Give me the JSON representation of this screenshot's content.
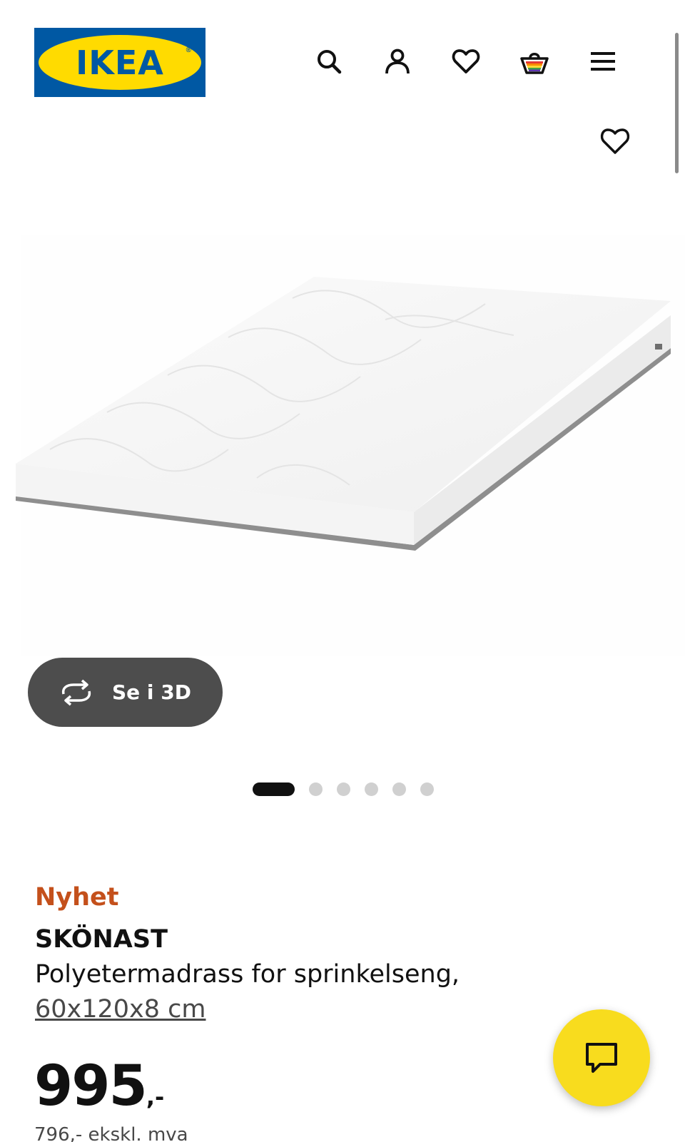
{
  "header": {
    "logo_text": "IKEA",
    "logo_reg_mark": "®",
    "icons": [
      "search-icon",
      "account-icon",
      "favourites-icon",
      "basket-icon",
      "menu-icon"
    ]
  },
  "gallery": {
    "view_3d_label": "Se i 3D",
    "image_count": 6,
    "active_image_index": 0
  },
  "product": {
    "badge": "Nyhet",
    "name": "SKÖNAST",
    "description": "Polyetermadrass for sprinkelseng,",
    "size": "60x120x8 cm",
    "price_integer": "995",
    "price_suffix": ",-",
    "price_ex_vat": "796,- ekskl. mva"
  },
  "colors": {
    "brand_blue": "#0058a3",
    "brand_yellow": "#ffdb00",
    "new_badge": "#c4501b",
    "chat_button": "#f8dc1e"
  }
}
